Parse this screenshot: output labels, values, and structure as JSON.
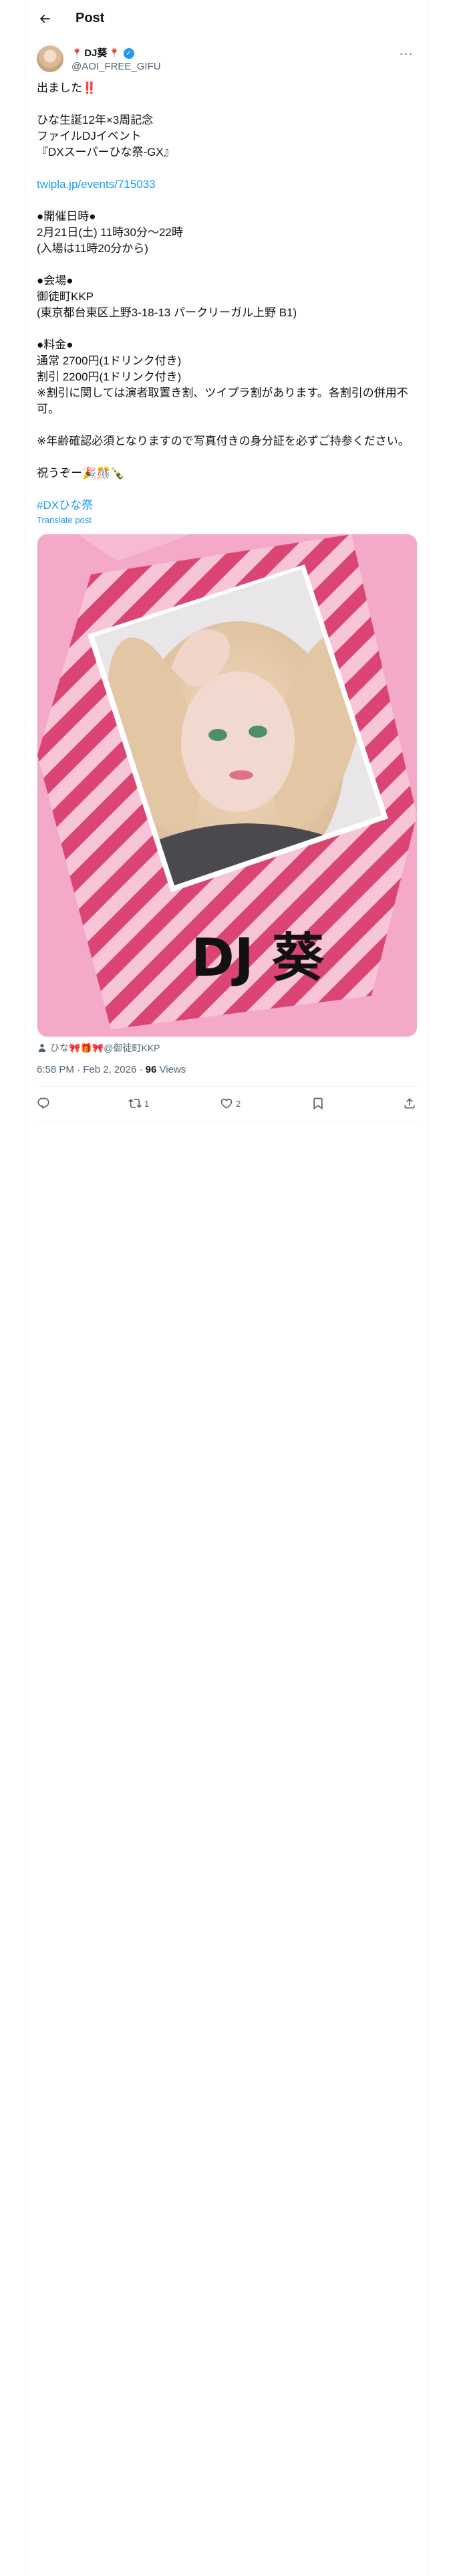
{
  "header": {
    "title": "Post",
    "back_icon": "arrow-left-icon"
  },
  "author": {
    "display_name": "DJ葵",
    "handle": "@AOI_FREE_GIFU",
    "verified_icon": "verified-badge-icon",
    "name_emoji": "📍"
  },
  "post": {
    "lines": [
      "出ました‼️",
      "",
      "ひな生誕12年×3周記念",
      "ファイルDJイベント",
      "『DXスーパーひな祭-GX』",
      "",
      "__LINK__",
      "",
      "●開催日時●",
      "2月21日(土) 11時30分〜22時",
      "(入場は11時20分から)",
      "",
      "●会場●",
      "御徒町KKP",
      "(東京都台東区上野3-18-13 パークリーガル上野 B1)",
      "",
      "●料金●",
      "通常 2700円(1ドリンク付き)",
      "割引 2200円(1ドリンク付き)",
      "※割引に関しては演者取置き割、ツイプラ割があります。各割引の併用不可。",
      "",
      "※年齢確認必須となりますので写真付きの身分証を必ずご持参ください。",
      "",
      "祝うぞー🎉🎊🍾",
      "",
      "__HASHTAG__"
    ],
    "link": "twipla.jp/events/715033",
    "hashtag": "#DXひな祭",
    "translate_label": "Translate post"
  },
  "media": {
    "signature_text": "DJ 葵",
    "colors": {
      "background": "#f4a9c9",
      "stripe_dark": "#d9406e",
      "stripe_light": "#f7c6d8"
    }
  },
  "tagged": {
    "icon": "person-icon",
    "text": "ひな🎀🎁🎀@御徒町KKP"
  },
  "meta": {
    "time": "6:58 PM",
    "date": "Feb 2, 2026",
    "views_count": "96",
    "views_label": "Views"
  },
  "actions": {
    "reply": {
      "icon": "reply-icon",
      "count": ""
    },
    "repost": {
      "icon": "repost-icon",
      "count": "1"
    },
    "like": {
      "icon": "heart-icon",
      "count": "2"
    },
    "bookmark": {
      "icon": "bookmark-icon",
      "count": ""
    },
    "share": {
      "icon": "share-icon",
      "count": ""
    }
  },
  "colors": {
    "accent": "#1d9bf0",
    "text": "#0f1419",
    "muted": "#536471"
  }
}
